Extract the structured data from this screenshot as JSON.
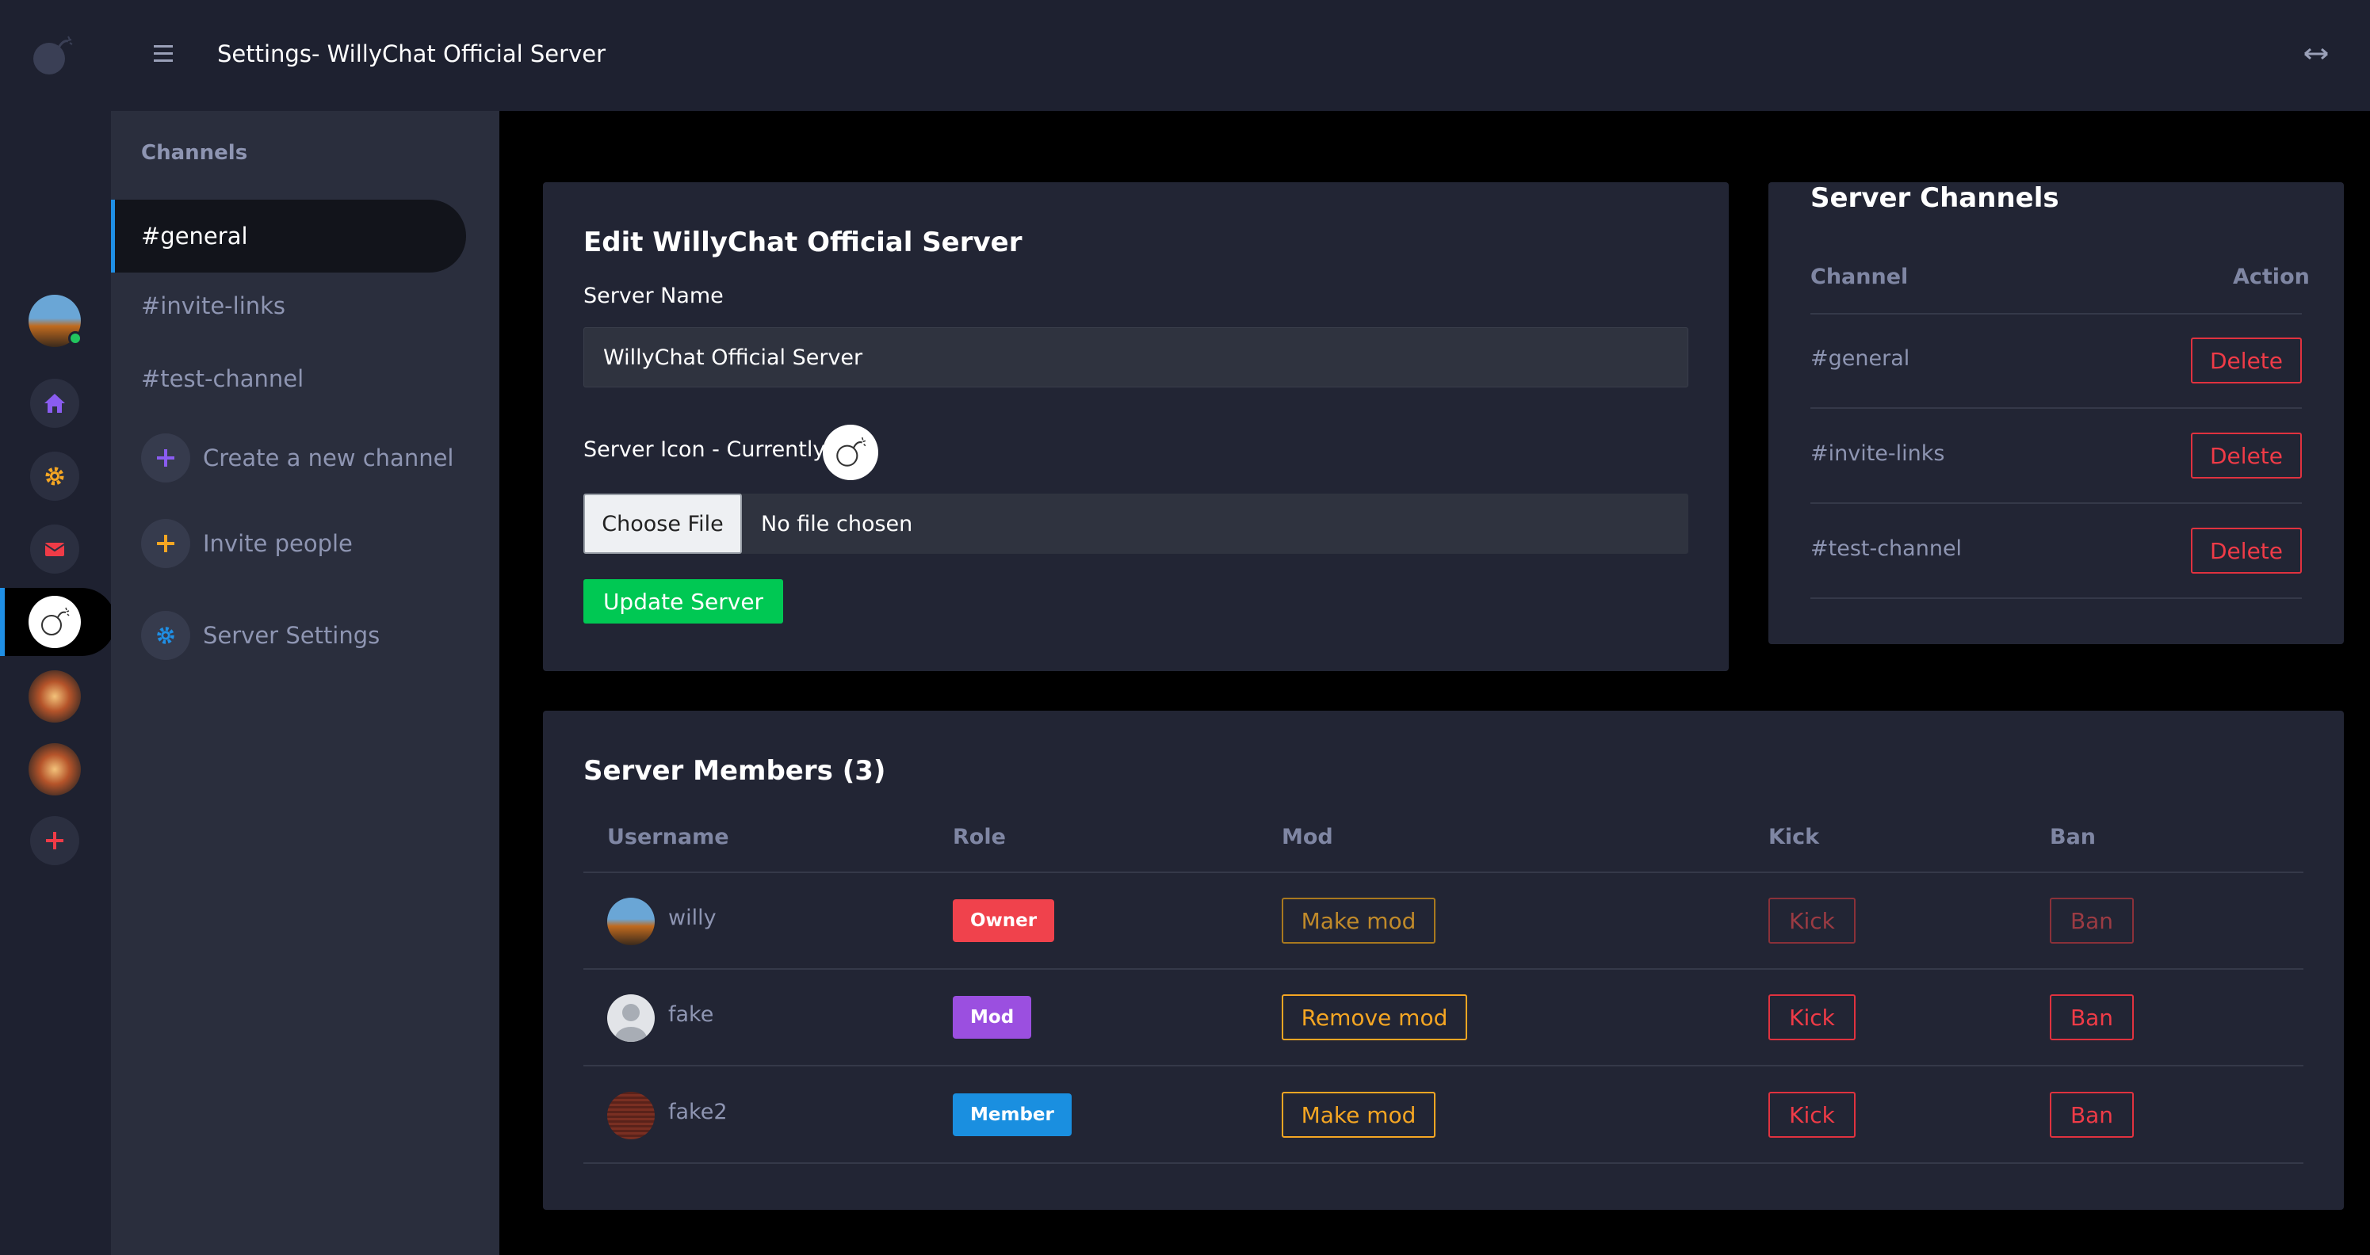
{
  "header": {
    "title": "Settings- WillyChat Official Server"
  },
  "rail": {
    "items": [
      "user-avatar",
      "home-icon",
      "gear-icon",
      "mail-icon",
      "server-willychat",
      "server-2",
      "server-3",
      "plus-icon"
    ]
  },
  "sidebar": {
    "heading": "Channels",
    "channels": [
      {
        "label": "#general",
        "active": true
      },
      {
        "label": "#invite-links",
        "active": false
      },
      {
        "label": "#test-channel",
        "active": false
      }
    ],
    "actions": {
      "create_channel": "Create a new channel",
      "invite_people": "Invite people",
      "server_settings": "Server Settings"
    }
  },
  "edit_server": {
    "title": "Edit WillyChat Official Server",
    "server_name_label": "Server Name",
    "server_name_value": "WillyChat Official Server",
    "server_icon_label": "Server Icon - Currently",
    "choose_file_label": "Choose File",
    "no_file_label": "No file chosen",
    "update_button": "Update Server"
  },
  "server_channels": {
    "title": "Server Channels",
    "col_channel": "Channel",
    "col_action": "Action",
    "rows": [
      {
        "name": "#general",
        "action": "Delete"
      },
      {
        "name": "#invite-links",
        "action": "Delete"
      },
      {
        "name": "#test-channel",
        "action": "Delete"
      }
    ]
  },
  "members": {
    "title": "Server Members (3)",
    "columns": {
      "username": "Username",
      "role": "Role",
      "mod": "Mod",
      "kick": "Kick",
      "ban": "Ban"
    },
    "rows": [
      {
        "username": "willy",
        "role": "Owner",
        "mod_action": "Make mod",
        "kick": "Kick",
        "ban": "Ban",
        "disabled": true
      },
      {
        "username": "fake",
        "role": "Mod",
        "mod_action": "Remove mod",
        "kick": "Kick",
        "ban": "Ban",
        "disabled": false
      },
      {
        "username": "fake2",
        "role": "Member",
        "mod_action": "Make mod",
        "kick": "Kick",
        "ban": "Ban",
        "disabled": false
      }
    ]
  },
  "colors": {
    "owner": "#f0424c",
    "mod": "#9b4fe0",
    "member": "#1a8fe0",
    "success": "#00c853",
    "danger": "#ef3b47",
    "warning": "#f5a623",
    "accent": "#1f8fe5"
  }
}
